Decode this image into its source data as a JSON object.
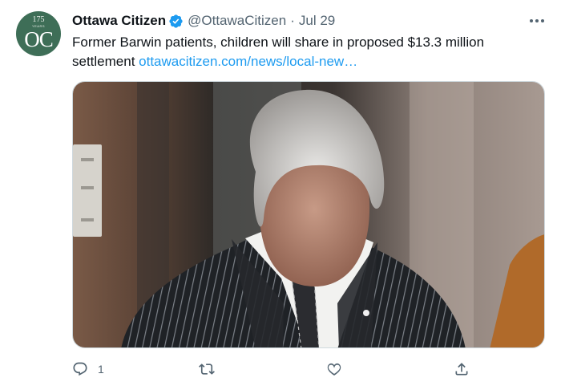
{
  "account": {
    "name": "Ottawa Citizen",
    "handle": "@OttawaCitizen",
    "separator": "·",
    "date": "Jul 29",
    "verified": true,
    "avatar": {
      "years_number": "175",
      "years_word": "YEARS",
      "monogram": "OC",
      "color": "#3e6e57"
    }
  },
  "tweet": {
    "text": "Former Barwin patients, children will share in proposed $13.3 million settlement ",
    "link_text": "ottawacitizen.com/news/local-new…",
    "link_color": "#1d9bf0"
  },
  "actions": {
    "reply_count": "1",
    "icons": [
      "reply-icon",
      "retweet-icon",
      "like-icon",
      "share-icon"
    ]
  },
  "more_icon": "more-options-icon"
}
